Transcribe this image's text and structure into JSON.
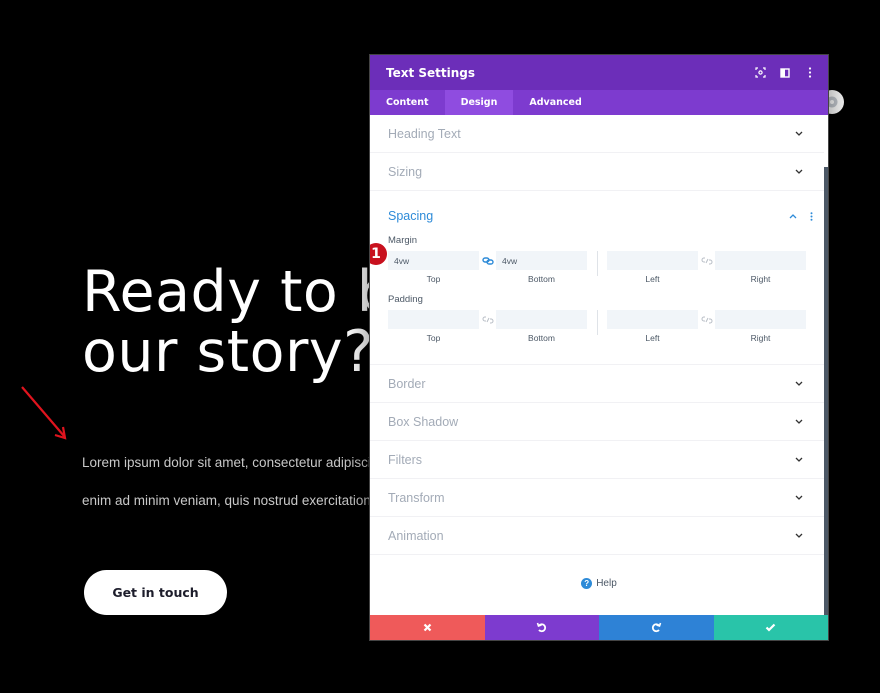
{
  "hero": {
    "title_lines": [
      "Ready to b",
      "our story?"
    ],
    "body_lines": [
      "Lorem ipsum dolor sit amet, consectetur adipiscin",
      "enim ad minim veniam, quis nostrud exercitation u"
    ],
    "cta_label": "Get in touch"
  },
  "annotation": {
    "arrow_color": "#e0141e",
    "badge_number": "1",
    "badge_color": "#c8111e"
  },
  "modal": {
    "title": "Text Settings",
    "header_icons": [
      "focus-icon",
      "split-view-icon",
      "kebab-menu-icon"
    ],
    "tabs": [
      {
        "label": "Content",
        "active": false
      },
      {
        "label": "Design",
        "active": true
      },
      {
        "label": "Advanced",
        "active": false
      }
    ],
    "sections_top": [
      {
        "label": "Heading Text"
      },
      {
        "label": "Sizing"
      }
    ],
    "spacing": {
      "label": "Spacing",
      "margin": {
        "label": "Margin",
        "top": {
          "value": "4vw",
          "label": "Top"
        },
        "bottom": {
          "value": "4vw",
          "label": "Bottom"
        },
        "left": {
          "value": "",
          "label": "Left"
        },
        "right": {
          "value": "",
          "label": "Right"
        },
        "vertical_linked": true,
        "horizontal_linked": false
      },
      "padding": {
        "label": "Padding",
        "top": {
          "value": "",
          "label": "Top"
        },
        "bottom": {
          "value": "",
          "label": "Bottom"
        },
        "left": {
          "value": "",
          "label": "Left"
        },
        "right": {
          "value": "",
          "label": "Right"
        },
        "vertical_linked": false,
        "horizontal_linked": false
      }
    },
    "sections_bottom": [
      {
        "label": "Border"
      },
      {
        "label": "Box Shadow"
      },
      {
        "label": "Filters"
      },
      {
        "label": "Transform"
      },
      {
        "label": "Animation"
      }
    ],
    "help_label": "Help",
    "footer": {
      "cancel_color": "#ef5a5a",
      "undo_color": "#7d3bcf",
      "redo_color": "#2e82d6",
      "save_color": "#29c4a9"
    }
  },
  "colors": {
    "header_bg": "#6c2eb9",
    "tabs_bg": "#7d3bcf",
    "accent_blue": "#2e8bd8"
  }
}
